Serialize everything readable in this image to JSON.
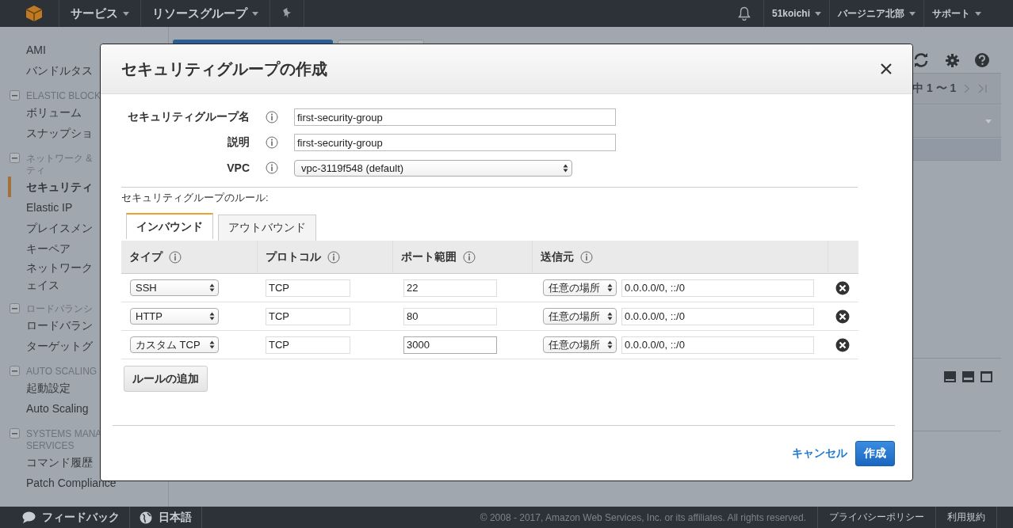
{
  "top_bar": {
    "menus": [
      {
        "label": "サービス"
      },
      {
        "label": "リソースグループ"
      }
    ],
    "right_menus": [
      {
        "label": "51koichi"
      },
      {
        "label": "バージニア北部"
      },
      {
        "label": "サポート"
      }
    ]
  },
  "sidebar": [
    {
      "kind": "item",
      "label": "AMI",
      "selected": false
    },
    {
      "kind": "item",
      "label": "バンドルタス",
      "selected": false
    },
    {
      "kind": "heading",
      "label": "ELASTIC BLOCK",
      "expanded": true
    },
    {
      "kind": "item",
      "label": "ボリューム",
      "selected": false
    },
    {
      "kind": "item",
      "label": "スナップショ",
      "selected": false
    },
    {
      "kind": "heading",
      "label": "ネットワーク &\nティ",
      "expanded": true
    },
    {
      "kind": "item",
      "label": "セキュリティ",
      "selected": true
    },
    {
      "kind": "item",
      "label": "Elastic IP",
      "selected": false
    },
    {
      "kind": "item",
      "label": "プレイスメン",
      "selected": false
    },
    {
      "kind": "item",
      "label": "キーペア",
      "selected": false
    },
    {
      "kind": "item",
      "lines": [
        "ネットワーク",
        "ェイス"
      ],
      "selected": false
    },
    {
      "kind": "heading",
      "label": "ロードバランシ",
      "expanded": true
    },
    {
      "kind": "item",
      "label": "ロードバラン",
      "selected": false
    },
    {
      "kind": "item",
      "label": "ターゲットグ",
      "selected": false
    },
    {
      "kind": "heading",
      "label": "AUTO SCALING",
      "expanded": true
    },
    {
      "kind": "item",
      "label": "起動設定",
      "selected": false
    },
    {
      "kind": "item",
      "label": "Auto Scaling",
      "selected": false
    },
    {
      "kind": "heading",
      "label": "SYSTEMS MANA\nSERVICES",
      "expanded": true
    },
    {
      "kind": "item",
      "label": "コマンド履歴",
      "selected": false
    },
    {
      "kind": "item",
      "label": "Patch Compliance",
      "selected": false
    }
  ],
  "background": {
    "pagination": "中 1 〜 1"
  },
  "dialog": {
    "title": "セキュリティグループの作成",
    "fields": [
      {
        "kind": "text",
        "label": "セキュリティグループ名",
        "value": "first-security-group"
      },
      {
        "kind": "text",
        "label": "説明",
        "value": "first-security-group"
      },
      {
        "kind": "select",
        "label": "VPC",
        "value": "vpc-3119f548 (default)"
      }
    ],
    "rules_label": "セキュリティグループのルール:",
    "tabs": [
      {
        "label": "インバウンド",
        "selected": true
      },
      {
        "label": "アウトバウンド",
        "selected": false
      }
    ],
    "columns": [
      "タイプ",
      "プロトコル",
      "ポート範囲",
      "送信元"
    ],
    "rows": [
      {
        "type": "SSH",
        "protocol": "TCP",
        "port": "22",
        "source": "任意の場所",
        "cidr": "0.0.0.0/0, ::/0"
      },
      {
        "type": "HTTP",
        "protocol": "TCP",
        "port": "80",
        "source": "任意の場所",
        "cidr": "0.0.0.0/0, ::/0"
      },
      {
        "type": "カスタム TCP",
        "protocol": "TCP",
        "port": "3000",
        "source": "任意の場所",
        "cidr": "0.0.0.0/0, ::/0"
      }
    ],
    "add_button": "ルールの追加",
    "cancel": "キャンセル",
    "create": "作成"
  },
  "footer": {
    "feedback": "フィードバック",
    "language": "日本語",
    "copyright": "© 2008 - 2017, Amazon Web Services, Inc. or its affiliates. All rights reserved.",
    "privacy": "プライバシーポリシー",
    "terms": "利用規約"
  }
}
